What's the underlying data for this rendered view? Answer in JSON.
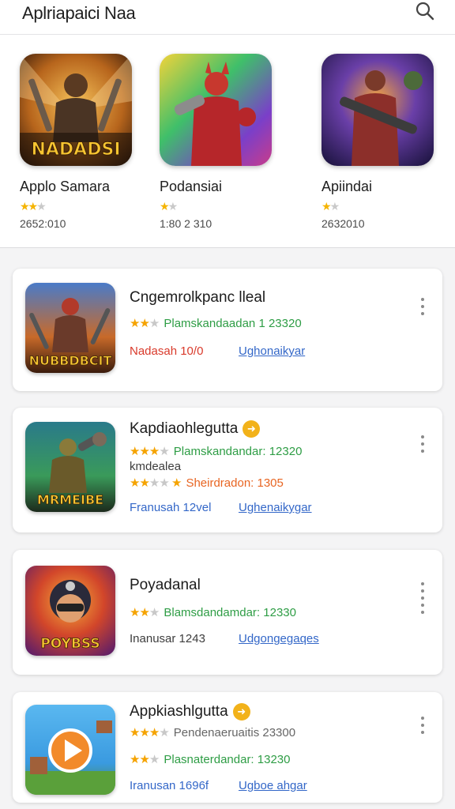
{
  "header": {
    "title": "Aplriapaici Naa",
    "search_icon": "search-icon"
  },
  "featured": [
    {
      "name": "Applo Samara",
      "count": "2652:010",
      "rating": 2.5,
      "icon_text": "NADADSI"
    },
    {
      "name": "Podansiai",
      "count": "1:80 2 310",
      "rating": 2.0,
      "icon_text": ""
    },
    {
      "name": "Apiindai",
      "count": "2632010",
      "rating": 2.0,
      "icon_text": ""
    }
  ],
  "list": [
    {
      "name": "Cngemrolkpanc lleal",
      "stars_rating": 2,
      "stat": "Plamskandaadan 1 23320",
      "secondary": "Nadasah 10/0",
      "link": "Ughonaikyar",
      "icon_text": "NUBBDBCIT"
    },
    {
      "name": "Kapdiaohlegutta",
      "badge": "➜",
      "stars_rating": 3,
      "stat": "Plamskandandar: 12320",
      "sub": "kmdealea",
      "stars2_rating": 3,
      "stat2": "Sheirdradon: 1305",
      "secondary": "Franusah 12vel",
      "link": "Ughenaikygar",
      "icon_text": "MRMEIBE"
    },
    {
      "name": "Poyadanal",
      "stars_rating": 2,
      "stat": "Blamsdandamdar: 12330",
      "secondary": "Inanusar 1243",
      "link": "Udgongegaqes",
      "icon_text": "POYBSS"
    },
    {
      "name": "Appkiashlgutta",
      "badge": "➜",
      "stars_rating": 3,
      "stat": "Pendenaeruaitis 23300",
      "stars2_rating": 2,
      "stat2": "Plasnaterdandar: 13230",
      "secondary": "Iranusan 1696f",
      "link": "Ugboe ahgar",
      "icon_text": ""
    }
  ],
  "colors": {
    "star": "#f5a300",
    "green_stat": "#2e9d45",
    "orange_stat": "#e86522",
    "link_blue": "#3367c8",
    "red": "#d93a2b",
    "badge": "#f2b21a"
  }
}
